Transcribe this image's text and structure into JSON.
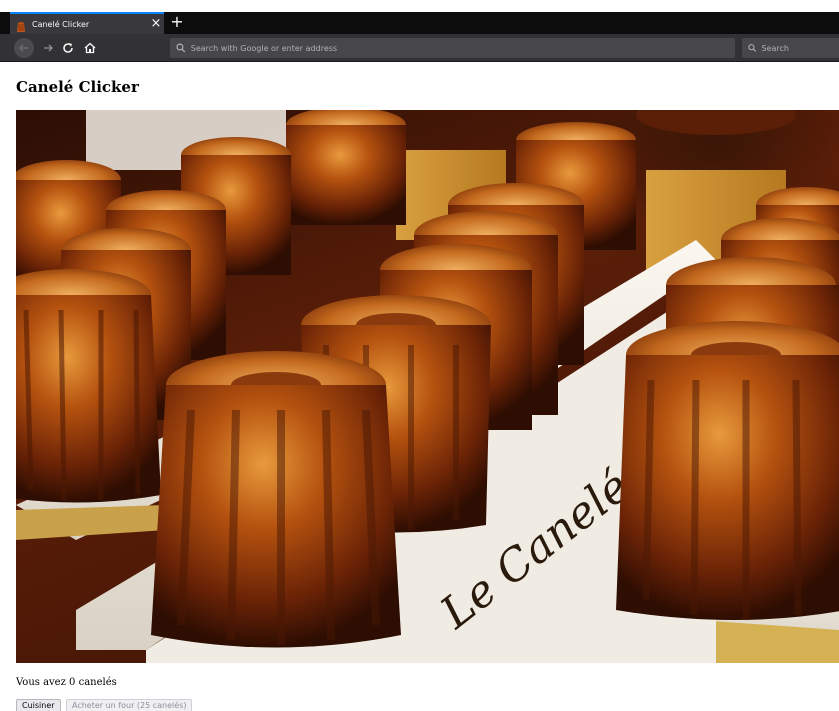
{
  "browser": {
    "tab_title": "Canelé Clicker",
    "tab_close": "×",
    "new_tab": "+",
    "url_placeholder": "Search with Google or enter address",
    "search_placeholder": "Search"
  },
  "page": {
    "title": "Canelé Clicker",
    "counter_text": "Vous avez 0 canelés",
    "cook_button": "Cuisiner",
    "buy_oven_button": "Acheter un four (25 canelés)"
  },
  "colors": {
    "tab_accent": "#0a84ff",
    "chrome_dark": "#0c0c0d",
    "toolbar": "#323234"
  }
}
